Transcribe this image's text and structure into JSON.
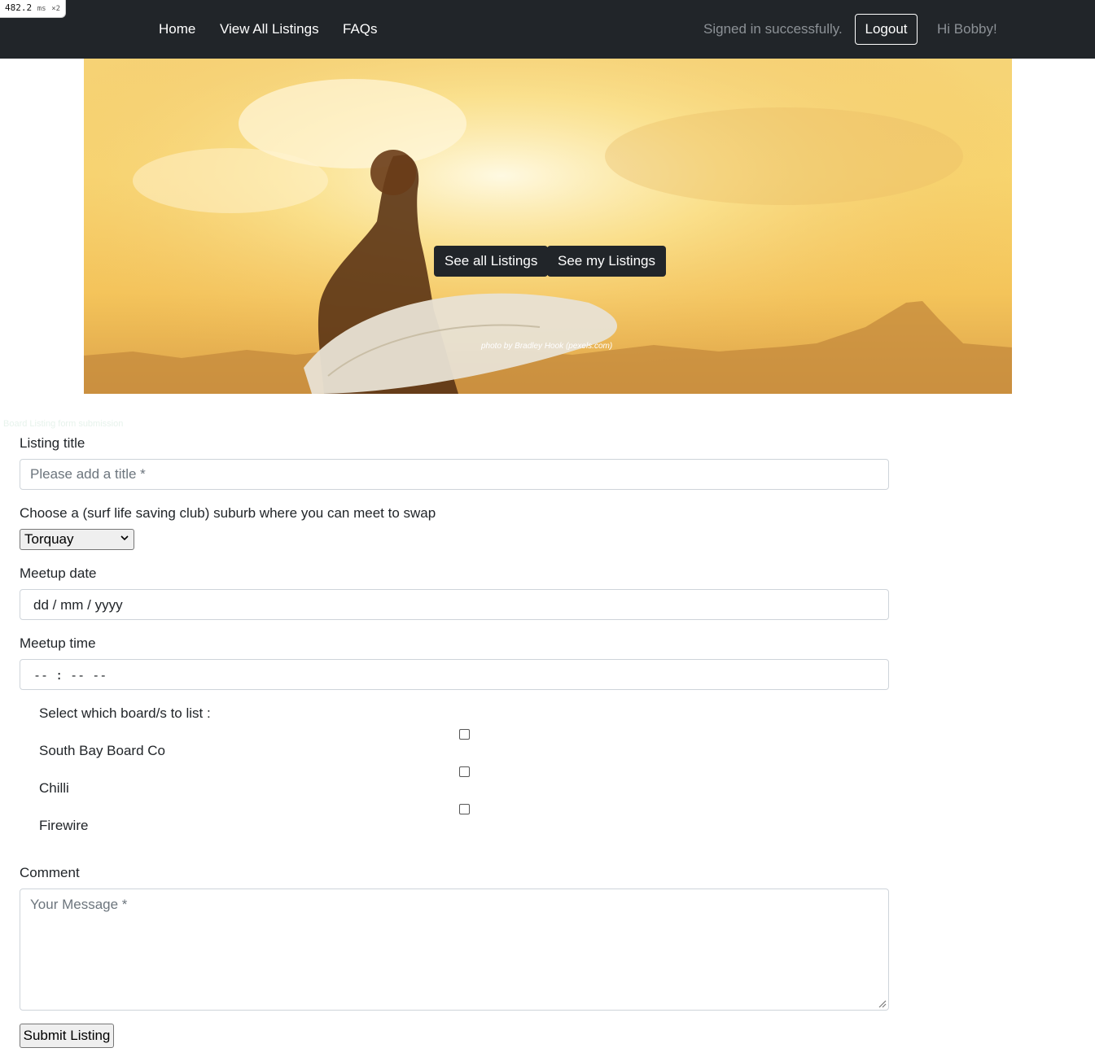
{
  "perf_badge": {
    "value": "482.2",
    "unit": "ms",
    "multiplier": "×2"
  },
  "nav": {
    "links": [
      "Home",
      "View All Listings",
      "FAQs"
    ],
    "status": "Signed in successfully.",
    "logout_label": "Logout",
    "greeting": "Hi Bobby!"
  },
  "hero": {
    "buttons": [
      "See all Listings",
      "See my Listings"
    ],
    "credit": "photo by Bradley Hook (pexels.com)"
  },
  "faint_text": "Board Listing form submission",
  "form": {
    "title_label": "Listing title",
    "title_placeholder": "Please add a title *",
    "suburb_label": "Choose a (surf life saving club) suburb where you can meet to swap",
    "suburb_selected": "Torquay",
    "date_label": "Meetup date",
    "date_value": "dd / mm / yyyy",
    "time_label": "Meetup time",
    "time_value": "-- : --  --",
    "boards_label": "Select which board/s to list :",
    "boards": [
      "South Bay Board Co",
      "Chilli",
      "Firewire"
    ],
    "comment_label": "Comment",
    "comment_placeholder": "Your Message *",
    "submit_label": "Submit Listing"
  },
  "colors": {
    "navbar": "#212529",
    "hero_button": "#212529",
    "muted_text": "#8c9196"
  }
}
